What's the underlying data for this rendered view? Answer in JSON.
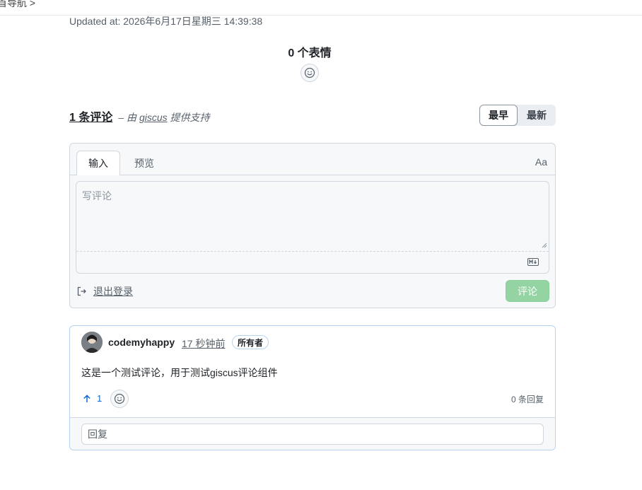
{
  "nav": {
    "crumb": "首导航 >"
  },
  "updated_text": "Updated at: 2026年6月17日星期三 14:39:38",
  "reactions": {
    "title": "0 个表情",
    "icon": "smiley-icon"
  },
  "comments_header": {
    "count": "1 条评论",
    "powered_prefix": "– 由",
    "powered_link": "giscus",
    "powered_suffix": "提供支持"
  },
  "sort": {
    "oldest": "最早",
    "newest": "最新"
  },
  "editor": {
    "tab_write": "输入",
    "tab_preview": "预览",
    "font_toggle": "Aa",
    "placeholder": "写评论",
    "markdown_icon": "markdown-icon",
    "signout": "退出登录",
    "submit": "评论"
  },
  "comment": {
    "author": "codemyhappy",
    "time": "17 秒钟前",
    "badge": "所有者",
    "body": "这是一个测试评论，用于测试giscus评论组件",
    "upvotes": "1",
    "replies": "0 条回复",
    "reply_placeholder": "回复"
  },
  "colors": {
    "accent": "#0969da",
    "submit_disabled": "#94d3a2",
    "border": "#d0d7de",
    "card_border": "#b6d4f2"
  }
}
